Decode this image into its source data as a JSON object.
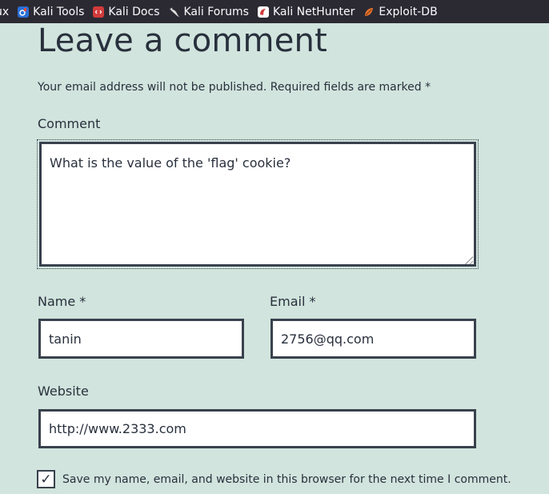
{
  "bookmarks": [
    {
      "label": "ux",
      "icon": "none"
    },
    {
      "label": "Kali Tools",
      "icon": "kali-tools-icon"
    },
    {
      "label": "Kali Docs",
      "icon": "kali-docs-icon"
    },
    {
      "label": "Kali Forums",
      "icon": "kali-forums-icon"
    },
    {
      "label": "Kali NetHunter",
      "icon": "kali-nethunter-icon"
    },
    {
      "label": "Exploit-DB",
      "icon": "exploit-db-icon"
    }
  ],
  "form": {
    "title": "Leave a comment",
    "notice": "Your email address will not be published. Required fields are marked *",
    "comment_label": "Comment",
    "comment_value": "What is the value of the 'flag' cookie?",
    "name_label": "Name *",
    "name_value": "tanin",
    "email_label": "Email *",
    "email_value": "2756@qq.com",
    "website_label": "Website",
    "website_value": "http://www.2333.com",
    "save_label": "Save my name, email, and website in this browser for the next time I comment.",
    "save_checked": true
  },
  "colors": {
    "page_bg": "#d1e4dd",
    "bookmark_bar_bg": "#2b2a33",
    "text": "#28303d",
    "field_border": "#39414d"
  }
}
